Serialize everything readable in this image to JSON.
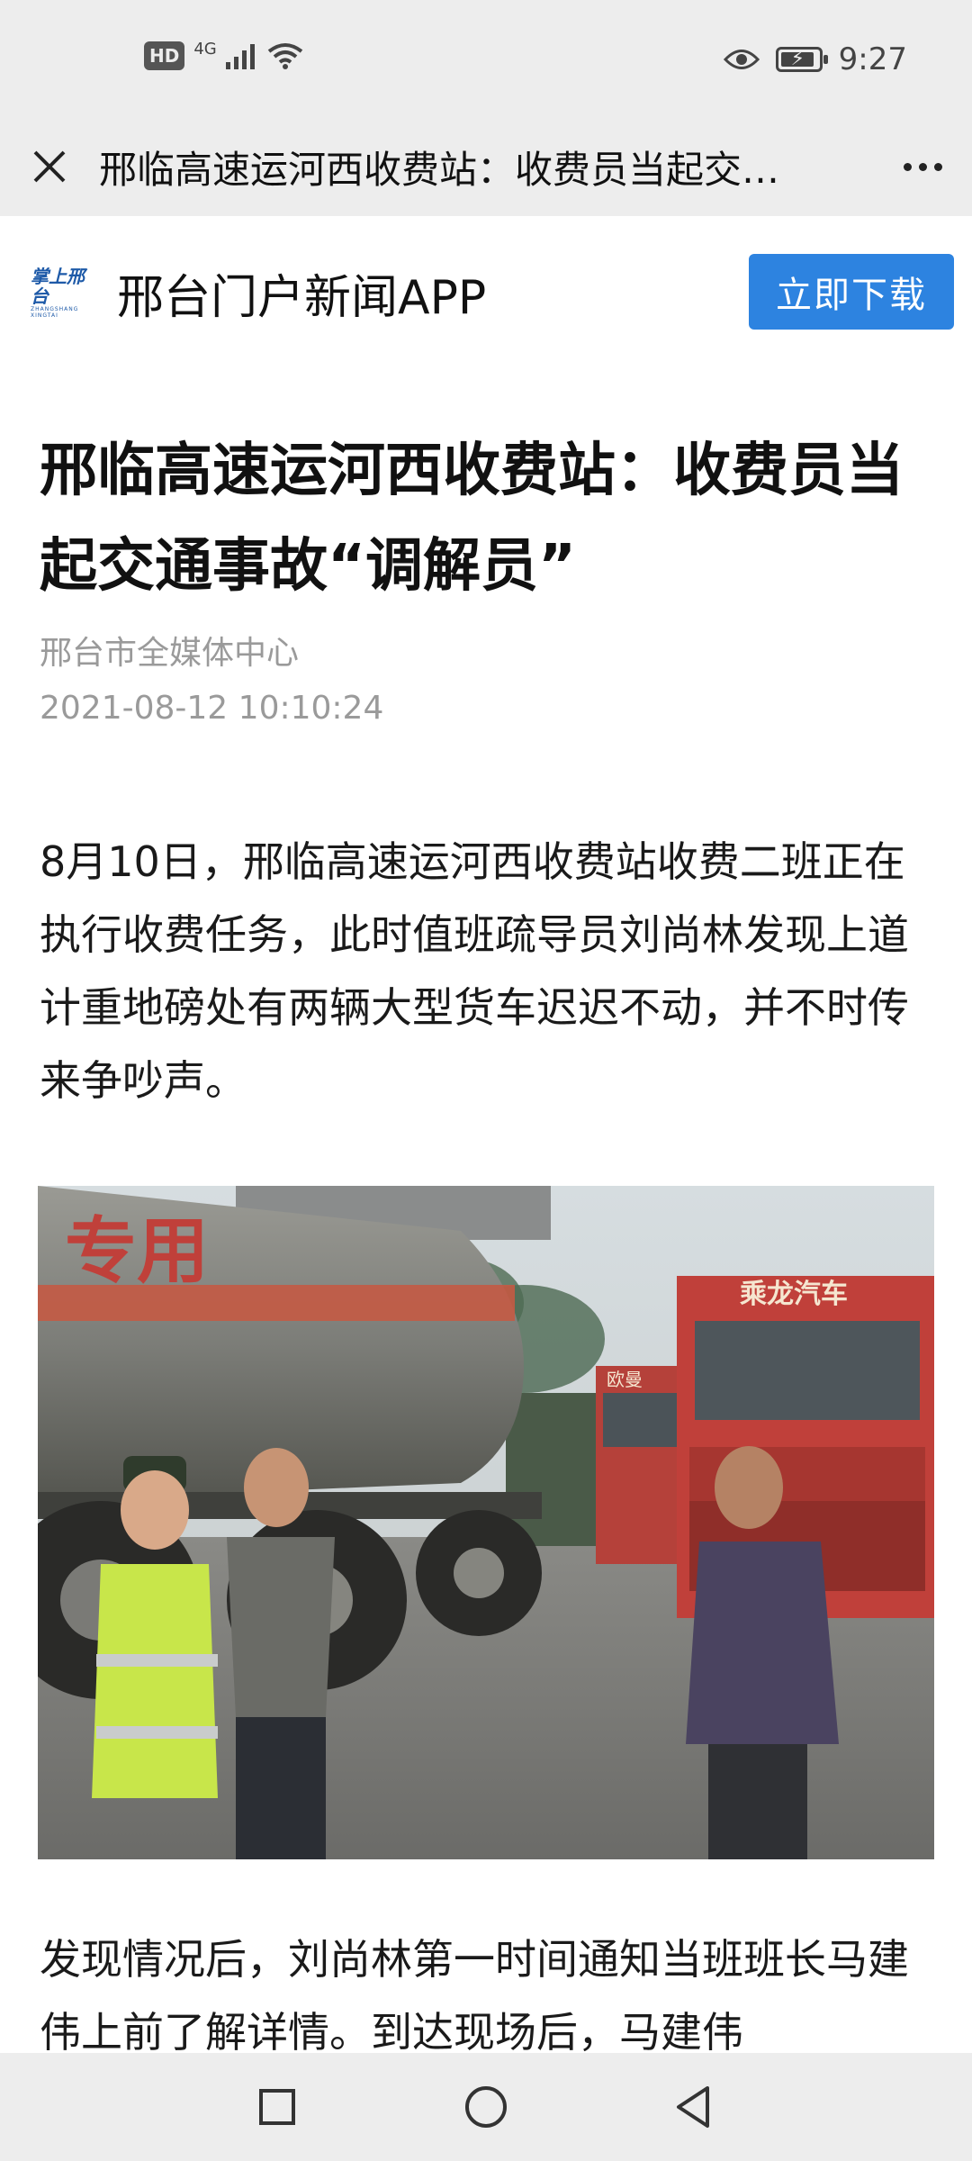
{
  "status_bar": {
    "hd_label": "HD",
    "network_label": "4G",
    "time": "9:27",
    "battery_level": 0.9,
    "icons": [
      "hd-icon",
      "signal-icon",
      "wifi-icon",
      "eye-icon",
      "battery-icon"
    ]
  },
  "title_bar": {
    "title": "邢临高速运河西收费站：收费员当起交…",
    "icons": [
      "close-icon",
      "more-icon"
    ]
  },
  "banner": {
    "logo_text": "掌上邢台",
    "logo_subtext": "ZHANGSHANG XINGTAI",
    "app_name": "邢台门户新闻APP",
    "download_label": "立即下载",
    "accent_color": "#2d83e0"
  },
  "article": {
    "title": "邢临高速运河西收费站：收费员当起交通事故“调解员”",
    "source": "邢台市全媒体中心",
    "date": "2021-08-12 10:10:24",
    "paragraph1": "8月10日，邢临高速运河西收费站收费二班正在执行收费任务，此时值班疏导员刘尚林发现上道计重地磅处有两辆大型货车迟迟不动，并不时传来争吵声。",
    "photo": {
      "tank_text": "专用",
      "truck_brand": "乘龙汽车",
      "subject": "news-photo"
    },
    "paragraph2": "发现情况后，刘尚林第一时间通知当班班长马建伟上前了解详情。到达现场后，马建伟"
  },
  "nav_bar": {
    "icons": [
      "recent-apps-icon",
      "home-icon",
      "back-icon"
    ]
  }
}
